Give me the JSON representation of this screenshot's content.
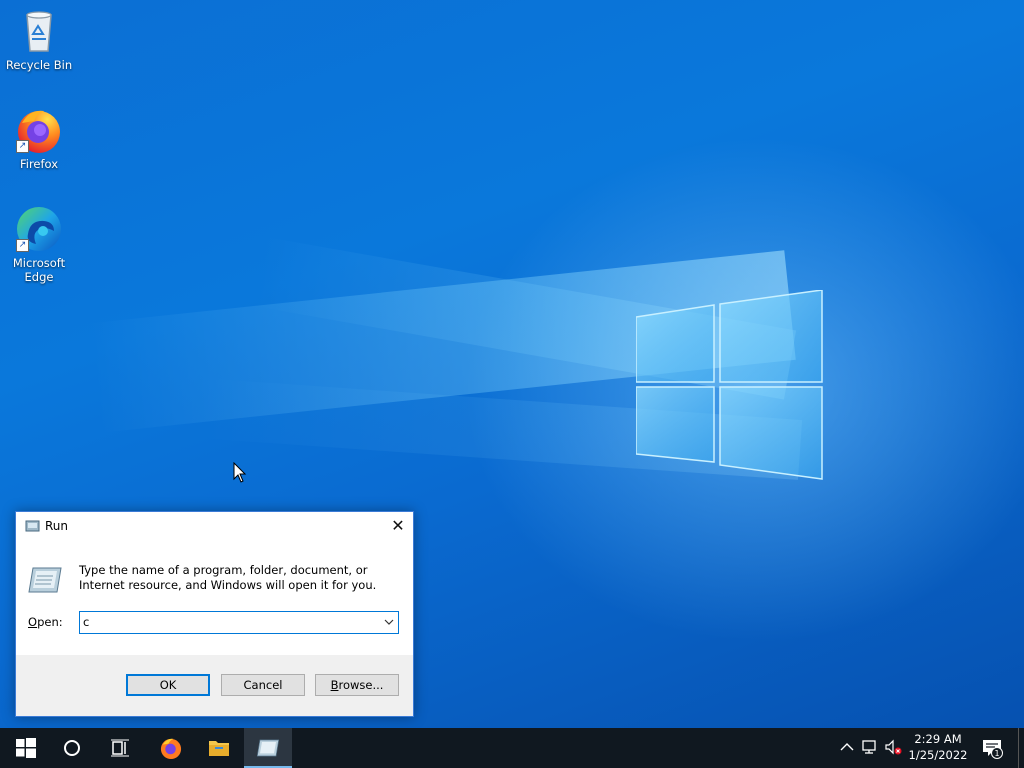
{
  "desktop": {
    "icons": [
      {
        "label": "Recycle Bin",
        "icon": "recycle-bin-icon"
      },
      {
        "label": "Firefox",
        "icon": "firefox-icon"
      },
      {
        "label": "Microsoft Edge",
        "icon": "edge-icon"
      }
    ]
  },
  "run_dialog": {
    "title": "Run",
    "description": "Type the name of a program, folder, document, or Internet resource, and Windows will open it for you.",
    "open_label_accel": "O",
    "open_label_rest": "pen:",
    "open_value": "c",
    "ok_label": "OK",
    "cancel_label": "Cancel",
    "browse_label_accel": "B",
    "browse_label_rest": "rowse...",
    "close_glyph": "✕"
  },
  "taskbar": {
    "pinned": [
      "windows-start-icon",
      "search-circle-icon",
      "task-view-icon",
      "firefox-icon",
      "file-explorer-icon",
      "run-icon"
    ],
    "active": "run-icon",
    "clock_time": "2:29 AM",
    "clock_date": "1/25/2022",
    "notification_count": "1",
    "tray_icons": [
      "chevron-up-icon",
      "network-icon",
      "volume-muted-icon"
    ]
  },
  "colors": {
    "accent": "#0078d7",
    "taskbar": "#101820",
    "wallpaper": "#0a78db"
  }
}
